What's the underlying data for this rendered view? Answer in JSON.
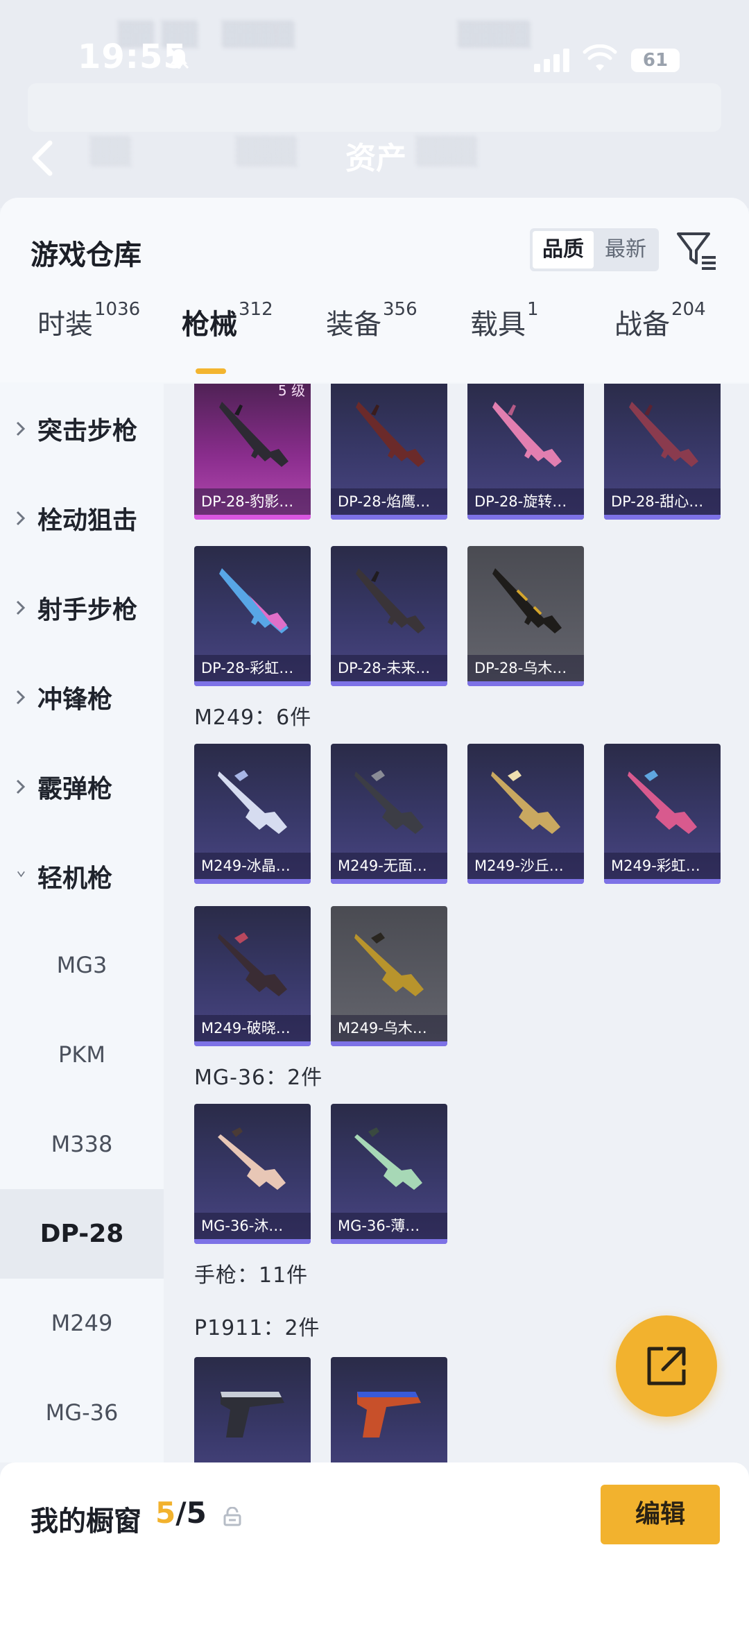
{
  "status_bar": {
    "time": "19:55",
    "battery": "61"
  },
  "header": {
    "tab_active": "资产"
  },
  "sheet": {
    "title": "游戏仓库",
    "sort": {
      "quality": "品质",
      "newest": "最新"
    },
    "categories": [
      {
        "label": "时装",
        "count": "1036"
      },
      {
        "label": "枪械",
        "count": "312"
      },
      {
        "label": "装备",
        "count": "356"
      },
      {
        "label": "载具",
        "count": "1"
      },
      {
        "label": "战备",
        "count": "204"
      }
    ]
  },
  "sidebar": {
    "groups": [
      "突击步枪",
      "栓动狙击",
      "射手步枪",
      "冲锋枪",
      "霰弹枪",
      "轻机枪"
    ],
    "sub_items": [
      "MG3",
      "PKM",
      "M338",
      "DP-28",
      "M249",
      "MG-36"
    ]
  },
  "content": {
    "dp28_top_badge": "5 级",
    "dp28_items": [
      "DP-28-豹影…",
      "DP-28-焰鹰…",
      "DP-28-旋转…",
      "DP-28-甜心…",
      "DP-28-彩虹…",
      "DP-28-未来…",
      "DP-28-乌木…"
    ],
    "m249_title": "M249：6件",
    "m249_items": [
      "M249-冰晶…",
      "M249-无面…",
      "M249-沙丘…",
      "M249-彩虹…",
      "M249-破晓…",
      "M249-乌木…"
    ],
    "mg36_title": "MG-36：2件",
    "mg36_items": [
      "MG-36-沐…",
      "MG-36-薄…"
    ],
    "pistol_title": "手枪：11件",
    "p1911_title": "P1911：2件"
  },
  "bottom": {
    "showcase_label": "我的橱窗",
    "showcase_current": "5",
    "showcase_total": "/5",
    "edit_button": "编辑"
  },
  "colors": {
    "accent": "#f2b22e",
    "card_purple": "#39396a",
    "card_epic": "#8a2d8d",
    "card_gray": "#5a5b63",
    "rarity_bar": "#7d72e6"
  },
  "icons": [
    "back-icon",
    "mute-icon",
    "signal-icon",
    "wifi-icon",
    "filter-icon",
    "chevron-right-icon",
    "chevron-down-icon",
    "share-icon",
    "lock-icon"
  ]
}
